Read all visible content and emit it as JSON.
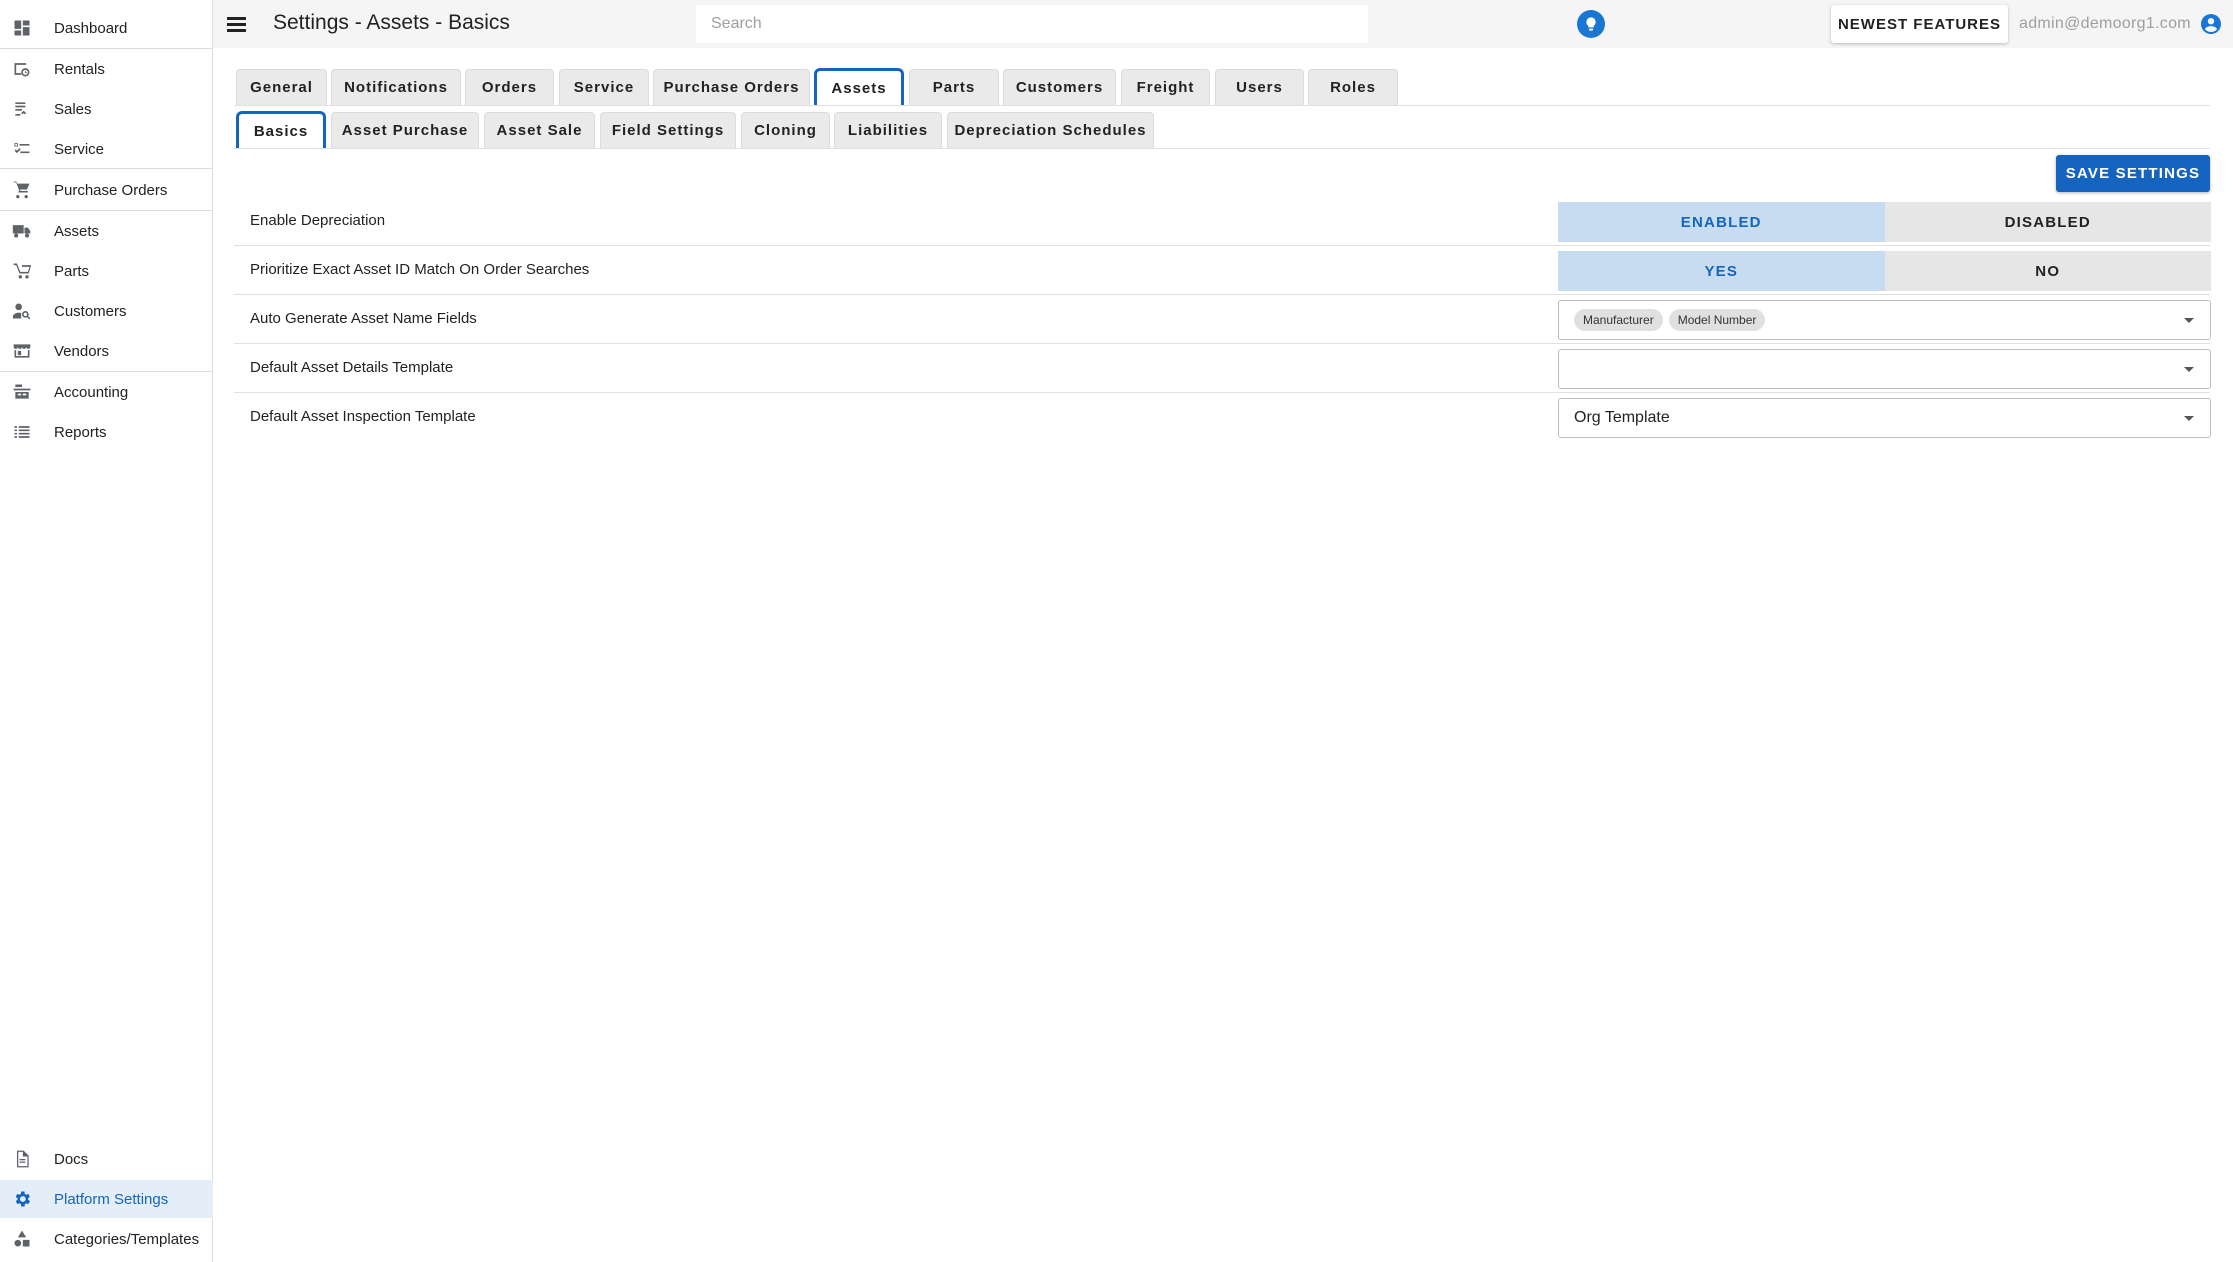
{
  "header": {
    "title": "Settings - Assets - Basics",
    "search_placeholder": "Search",
    "newest_features_label": "NEWEST FEATURES",
    "user_email": "admin@demoorg1.com"
  },
  "sidebar": {
    "items": [
      {
        "label": "Dashboard",
        "icon": "dashboard-icon"
      },
      {
        "label": "Rentals",
        "icon": "rentals-icon"
      },
      {
        "label": "Sales",
        "icon": "sales-icon"
      },
      {
        "label": "Service",
        "icon": "service-icon"
      },
      {
        "label": "Purchase Orders",
        "icon": "cart-icon"
      },
      {
        "label": "Assets",
        "icon": "truck-icon"
      },
      {
        "label": "Parts",
        "icon": "parts-icon"
      },
      {
        "label": "Customers",
        "icon": "customer-search-icon"
      },
      {
        "label": "Vendors",
        "icon": "vendors-icon"
      },
      {
        "label": "Accounting",
        "icon": "accounting-icon"
      },
      {
        "label": "Reports",
        "icon": "list-icon"
      }
    ],
    "bottom_items": [
      {
        "label": "Docs",
        "icon": "document-icon"
      },
      {
        "label": "Platform Settings",
        "icon": "gear-icon",
        "active": true
      },
      {
        "label": "Categories/Templates",
        "icon": "shapes-icon"
      }
    ]
  },
  "tabs": {
    "primary": [
      "General",
      "Notifications",
      "Orders",
      "Service",
      "Purchase Orders",
      "Assets",
      "Parts",
      "Customers",
      "Freight",
      "Users",
      "Roles"
    ],
    "primary_active": "Assets",
    "secondary": [
      "Basics",
      "Asset Purchase",
      "Asset Sale",
      "Field Settings",
      "Cloning",
      "Liabilities",
      "Depreciation Schedules"
    ],
    "secondary_active": "Basics"
  },
  "actions": {
    "save_label": "SAVE SETTINGS"
  },
  "settings": {
    "enable_depreciation": {
      "label": "Enable Depreciation",
      "options": [
        "ENABLED",
        "DISABLED"
      ],
      "selected": "ENABLED"
    },
    "prioritize_exact_match": {
      "label": "Prioritize Exact Asset ID Match On Order Searches",
      "options": [
        "YES",
        "NO"
      ],
      "selected": "YES"
    },
    "auto_generate_name": {
      "label": "Auto Generate Asset Name Fields",
      "chips": [
        "Manufacturer",
        "Model Number"
      ]
    },
    "default_details_template": {
      "label": "Default Asset Details Template",
      "value": ""
    },
    "default_inspection_template": {
      "label": "Default Asset Inspection Template",
      "value": "Org Template"
    }
  },
  "colors": {
    "accent": "#1565c0",
    "toggle_on_bg": "#c8dcf1",
    "toggle_off_bg": "#e6e6e6",
    "topbar_bg": "#f5f5f5"
  }
}
